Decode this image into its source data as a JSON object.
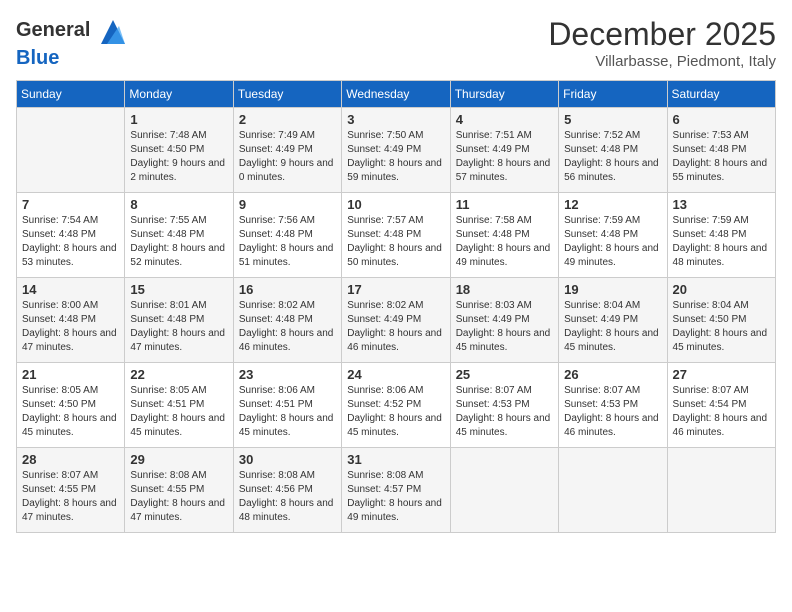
{
  "logo": {
    "general": "General",
    "blue": "Blue"
  },
  "title": {
    "month_year": "December 2025",
    "location": "Villarbasse, Piedmont, Italy"
  },
  "days_of_week": [
    "Sunday",
    "Monday",
    "Tuesday",
    "Wednesday",
    "Thursday",
    "Friday",
    "Saturday"
  ],
  "weeks": [
    [
      {
        "day": "",
        "sunrise": "",
        "sunset": "",
        "daylight": ""
      },
      {
        "day": "1",
        "sunrise": "Sunrise: 7:48 AM",
        "sunset": "Sunset: 4:50 PM",
        "daylight": "Daylight: 9 hours and 2 minutes."
      },
      {
        "day": "2",
        "sunrise": "Sunrise: 7:49 AM",
        "sunset": "Sunset: 4:49 PM",
        "daylight": "Daylight: 9 hours and 0 minutes."
      },
      {
        "day": "3",
        "sunrise": "Sunrise: 7:50 AM",
        "sunset": "Sunset: 4:49 PM",
        "daylight": "Daylight: 8 hours and 59 minutes."
      },
      {
        "day": "4",
        "sunrise": "Sunrise: 7:51 AM",
        "sunset": "Sunset: 4:49 PM",
        "daylight": "Daylight: 8 hours and 57 minutes."
      },
      {
        "day": "5",
        "sunrise": "Sunrise: 7:52 AM",
        "sunset": "Sunset: 4:48 PM",
        "daylight": "Daylight: 8 hours and 56 minutes."
      },
      {
        "day": "6",
        "sunrise": "Sunrise: 7:53 AM",
        "sunset": "Sunset: 4:48 PM",
        "daylight": "Daylight: 8 hours and 55 minutes."
      }
    ],
    [
      {
        "day": "7",
        "sunrise": "Sunrise: 7:54 AM",
        "sunset": "Sunset: 4:48 PM",
        "daylight": "Daylight: 8 hours and 53 minutes."
      },
      {
        "day": "8",
        "sunrise": "Sunrise: 7:55 AM",
        "sunset": "Sunset: 4:48 PM",
        "daylight": "Daylight: 8 hours and 52 minutes."
      },
      {
        "day": "9",
        "sunrise": "Sunrise: 7:56 AM",
        "sunset": "Sunset: 4:48 PM",
        "daylight": "Daylight: 8 hours and 51 minutes."
      },
      {
        "day": "10",
        "sunrise": "Sunrise: 7:57 AM",
        "sunset": "Sunset: 4:48 PM",
        "daylight": "Daylight: 8 hours and 50 minutes."
      },
      {
        "day": "11",
        "sunrise": "Sunrise: 7:58 AM",
        "sunset": "Sunset: 4:48 PM",
        "daylight": "Daylight: 8 hours and 49 minutes."
      },
      {
        "day": "12",
        "sunrise": "Sunrise: 7:59 AM",
        "sunset": "Sunset: 4:48 PM",
        "daylight": "Daylight: 8 hours and 49 minutes."
      },
      {
        "day": "13",
        "sunrise": "Sunrise: 7:59 AM",
        "sunset": "Sunset: 4:48 PM",
        "daylight": "Daylight: 8 hours and 48 minutes."
      }
    ],
    [
      {
        "day": "14",
        "sunrise": "Sunrise: 8:00 AM",
        "sunset": "Sunset: 4:48 PM",
        "daylight": "Daylight: 8 hours and 47 minutes."
      },
      {
        "day": "15",
        "sunrise": "Sunrise: 8:01 AM",
        "sunset": "Sunset: 4:48 PM",
        "daylight": "Daylight: 8 hours and 47 minutes."
      },
      {
        "day": "16",
        "sunrise": "Sunrise: 8:02 AM",
        "sunset": "Sunset: 4:48 PM",
        "daylight": "Daylight: 8 hours and 46 minutes."
      },
      {
        "day": "17",
        "sunrise": "Sunrise: 8:02 AM",
        "sunset": "Sunset: 4:49 PM",
        "daylight": "Daylight: 8 hours and 46 minutes."
      },
      {
        "day": "18",
        "sunrise": "Sunrise: 8:03 AM",
        "sunset": "Sunset: 4:49 PM",
        "daylight": "Daylight: 8 hours and 45 minutes."
      },
      {
        "day": "19",
        "sunrise": "Sunrise: 8:04 AM",
        "sunset": "Sunset: 4:49 PM",
        "daylight": "Daylight: 8 hours and 45 minutes."
      },
      {
        "day": "20",
        "sunrise": "Sunrise: 8:04 AM",
        "sunset": "Sunset: 4:50 PM",
        "daylight": "Daylight: 8 hours and 45 minutes."
      }
    ],
    [
      {
        "day": "21",
        "sunrise": "Sunrise: 8:05 AM",
        "sunset": "Sunset: 4:50 PM",
        "daylight": "Daylight: 8 hours and 45 minutes."
      },
      {
        "day": "22",
        "sunrise": "Sunrise: 8:05 AM",
        "sunset": "Sunset: 4:51 PM",
        "daylight": "Daylight: 8 hours and 45 minutes."
      },
      {
        "day": "23",
        "sunrise": "Sunrise: 8:06 AM",
        "sunset": "Sunset: 4:51 PM",
        "daylight": "Daylight: 8 hours and 45 minutes."
      },
      {
        "day": "24",
        "sunrise": "Sunrise: 8:06 AM",
        "sunset": "Sunset: 4:52 PM",
        "daylight": "Daylight: 8 hours and 45 minutes."
      },
      {
        "day": "25",
        "sunrise": "Sunrise: 8:07 AM",
        "sunset": "Sunset: 4:53 PM",
        "daylight": "Daylight: 8 hours and 45 minutes."
      },
      {
        "day": "26",
        "sunrise": "Sunrise: 8:07 AM",
        "sunset": "Sunset: 4:53 PM",
        "daylight": "Daylight: 8 hours and 46 minutes."
      },
      {
        "day": "27",
        "sunrise": "Sunrise: 8:07 AM",
        "sunset": "Sunset: 4:54 PM",
        "daylight": "Daylight: 8 hours and 46 minutes."
      }
    ],
    [
      {
        "day": "28",
        "sunrise": "Sunrise: 8:07 AM",
        "sunset": "Sunset: 4:55 PM",
        "daylight": "Daylight: 8 hours and 47 minutes."
      },
      {
        "day": "29",
        "sunrise": "Sunrise: 8:08 AM",
        "sunset": "Sunset: 4:55 PM",
        "daylight": "Daylight: 8 hours and 47 minutes."
      },
      {
        "day": "30",
        "sunrise": "Sunrise: 8:08 AM",
        "sunset": "Sunset: 4:56 PM",
        "daylight": "Daylight: 8 hours and 48 minutes."
      },
      {
        "day": "31",
        "sunrise": "Sunrise: 8:08 AM",
        "sunset": "Sunset: 4:57 PM",
        "daylight": "Daylight: 8 hours and 49 minutes."
      },
      {
        "day": "",
        "sunrise": "",
        "sunset": "",
        "daylight": ""
      },
      {
        "day": "",
        "sunrise": "",
        "sunset": "",
        "daylight": ""
      },
      {
        "day": "",
        "sunrise": "",
        "sunset": "",
        "daylight": ""
      }
    ]
  ]
}
